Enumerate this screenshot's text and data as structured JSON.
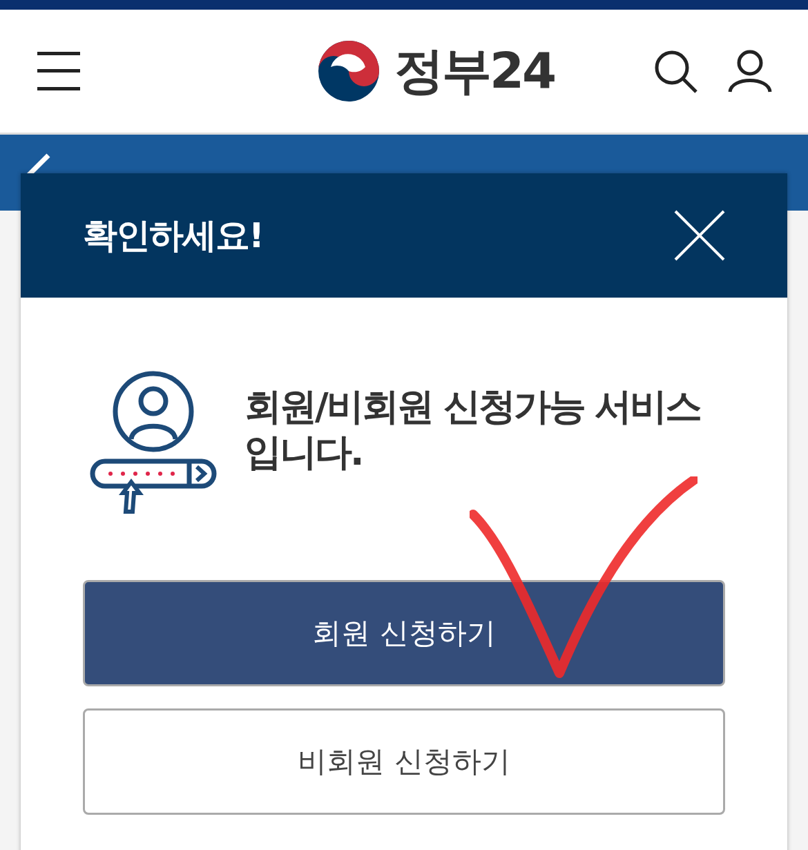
{
  "header": {
    "logo_text": "정부24"
  },
  "dialog": {
    "title": "확인하세요!",
    "message": "회원/비회원 신청가능 서비스 입니다.",
    "buttons": [
      {
        "label": "회원 신청하기",
        "kind": "primary"
      },
      {
        "label": "비회원 신청하기",
        "kind": "secondary"
      }
    ]
  }
}
